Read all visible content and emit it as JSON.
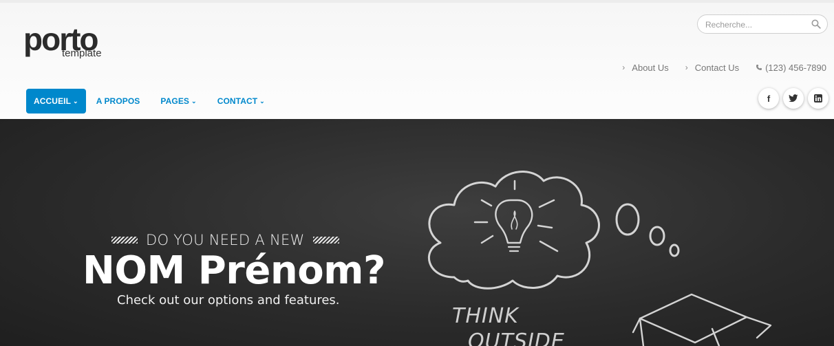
{
  "header": {
    "logo": {
      "main": "porto",
      "sub": "template"
    },
    "search": {
      "placeholder": "Recherche..."
    },
    "top_links": [
      {
        "label": "About Us",
        "icon": "chevron-right-icon"
      },
      {
        "label": "Contact Us",
        "icon": "chevron-right-icon"
      },
      {
        "label": "(123) 456-7890",
        "icon": "phone-icon"
      }
    ],
    "nav": [
      {
        "label": "ACCUEIL",
        "active": true
      },
      {
        "label": "A PROPOS",
        "active": false
      },
      {
        "label": "PAGES",
        "active": false
      },
      {
        "label": "CONTACT",
        "active": false
      }
    ],
    "social": [
      {
        "label": "f",
        "icon": "facebook-icon"
      },
      {
        "label": "",
        "icon": "twitter-icon"
      },
      {
        "label": "in",
        "icon": "linkedin-icon"
      }
    ]
  },
  "hero": {
    "pretitle": "DO YOU NEED A NEW",
    "title": "NOM Prénom?",
    "subtitle": "Check out our options and features.",
    "chalk_text": [
      "THINK",
      "OUTSIDE"
    ]
  },
  "colors": {
    "accent": "#0088cc",
    "hero_background": "#2b2b2b"
  }
}
